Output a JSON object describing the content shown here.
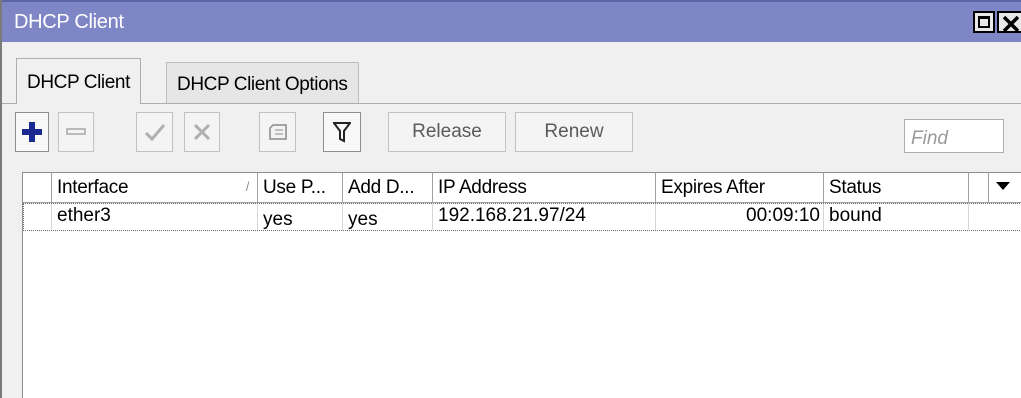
{
  "window": {
    "title": "DHCP Client",
    "controls": [
      "restore-icon",
      "close-icon"
    ],
    "title_color": "#7f86c5"
  },
  "tabs": [
    {
      "label": "DHCP Client",
      "active": true
    },
    {
      "label": "DHCP Client Options",
      "active": false
    }
  ],
  "toolbar": {
    "buttons": [
      {
        "name": "add-button",
        "icon": "plus-icon",
        "enabled": true
      },
      {
        "name": "remove-button",
        "icon": "minus-icon",
        "enabled": false
      },
      {
        "name": "enable-button",
        "icon": "check-icon",
        "enabled": false
      },
      {
        "name": "disable-button",
        "icon": "cross-icon",
        "enabled": false
      },
      {
        "name": "comment-button",
        "icon": "note-icon",
        "enabled": false
      },
      {
        "name": "filter-button",
        "icon": "filter-icon",
        "enabled": true
      }
    ],
    "release_label": "Release",
    "renew_label": "Renew",
    "find_placeholder": "Find",
    "accent_color": "#1b2a8e"
  },
  "table": {
    "columns": [
      "Interface",
      "Use P...",
      "Add D...",
      "IP Address",
      "Expires After",
      "Status"
    ],
    "sorted_column": "Interface",
    "rows": [
      {
        "interface": "ether3",
        "use_peer_dns": "yes",
        "add_default_route": "yes",
        "ip_address": "192.168.21.97/24",
        "expires_after": "00:09:10",
        "status": "bound"
      }
    ]
  }
}
